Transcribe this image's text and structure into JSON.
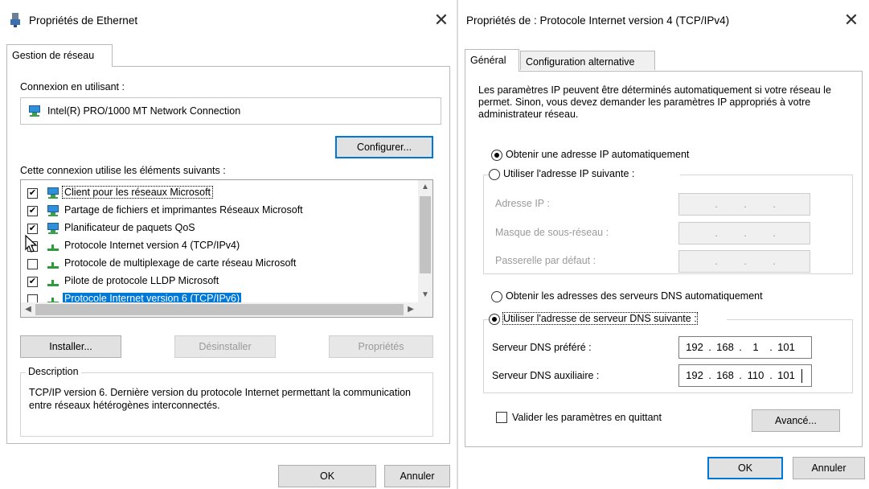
{
  "left": {
    "title": "Propriétés de Ethernet",
    "close": "✕",
    "tab": "Gestion de réseau",
    "connect_using_label": "Connexion en utilisant :",
    "adapter_name": "Intel(R) PRO/1000 MT Network Connection",
    "configure_button": "Configurer...",
    "items_label": "Cette connexion utilise les éléments suivants :",
    "items": [
      {
        "label": "Client pour les réseaux Microsoft",
        "checked": "✔",
        "icon": "network-client-icon"
      },
      {
        "label": "Partage de fichiers et imprimantes Réseaux Microsoft",
        "checked": "✔",
        "icon": "file-sharing-icon"
      },
      {
        "label": "Planificateur de paquets QoS",
        "checked": "✔",
        "icon": "qos-icon"
      },
      {
        "label": "Protocole Internet version 4 (TCP/IPv4)",
        "checked": "✔",
        "icon": "protocol-icon"
      },
      {
        "label": "Protocole de multiplexage de carte réseau Microsoft",
        "checked": "",
        "icon": "protocol-icon"
      },
      {
        "label": "Pilote de protocole LLDP Microsoft",
        "checked": "✔",
        "icon": "protocol-icon"
      },
      {
        "label": "Protocole Internet version 6 (TCP/IPv6)",
        "checked": "",
        "icon": "protocol-icon"
      }
    ],
    "install_button": "Installer...",
    "uninstall_button": "Désinstaller",
    "properties_button": "Propriétés",
    "description_title": "Description",
    "description_text": "TCP/IP version 6. Dernière version du protocole Internet permettant la communication entre réseaux hétérogènes interconnectés.",
    "ok_button": "OK",
    "cancel_button": "Annuler"
  },
  "right": {
    "title": "Propriétés de : Protocole Internet version 4 (TCP/IPv4)",
    "close": "✕",
    "tabs": [
      "Général",
      "Configuration alternative"
    ],
    "intro": "Les paramètres IP peuvent être déterminés automatiquement si votre réseau le permet. Sinon, vous devez demander les paramètres IP appropriés à votre administrateur réseau.",
    "ip_auto": "Obtenir une adresse IP automatiquement",
    "ip_manual": "Utiliser l'adresse IP suivante :",
    "ip_address_label": "Adresse IP :",
    "subnet_label": "Masque de sous-réseau :",
    "gateway_label": "Passerelle par défaut :",
    "dns_auto": "Obtenir les adresses des serveurs DNS automatiquement",
    "dns_manual": "Utiliser l'adresse de serveur DNS suivante :",
    "dns_pref_label": "Serveur DNS préféré :",
    "dns_pref": [
      "192",
      "168",
      "1",
      "101"
    ],
    "dns_alt_label": "Serveur DNS auxiliaire :",
    "dns_alt": [
      "192",
      "168",
      "110",
      "101"
    ],
    "validate_label": "Valider les paramètres en quittant",
    "advanced_button": "Avancé...",
    "ok_button": "OK",
    "cancel_button": "Annuler"
  },
  "colors": {
    "selection": "#0078d7",
    "button_face": "#e1e1e1"
  }
}
